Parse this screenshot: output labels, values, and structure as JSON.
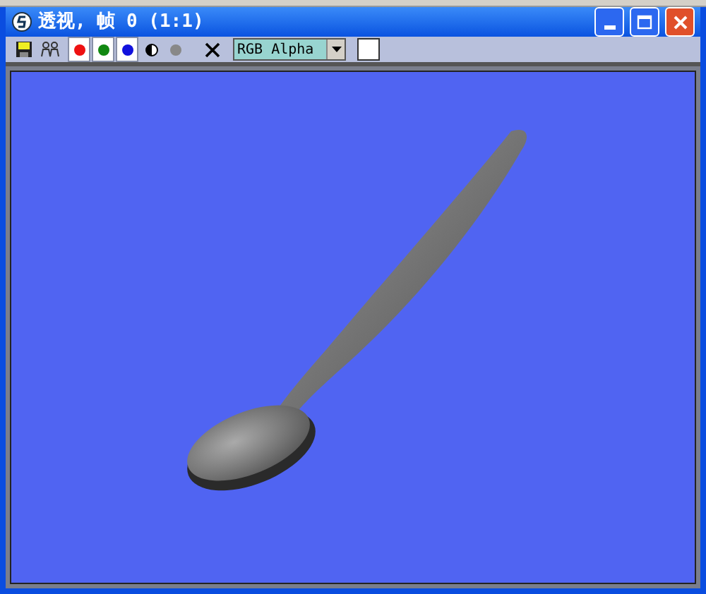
{
  "window": {
    "title": "透视, 帧 0 (1:1)"
  },
  "toolbar": {
    "channels": [
      {
        "kind": "red",
        "on": true
      },
      {
        "kind": "green",
        "on": true
      },
      {
        "kind": "blue",
        "on": true
      },
      {
        "kind": "mono",
        "on": false
      },
      {
        "kind": "alpha",
        "on": false
      }
    ],
    "channel_select": {
      "value": "RGB Alpha"
    }
  }
}
